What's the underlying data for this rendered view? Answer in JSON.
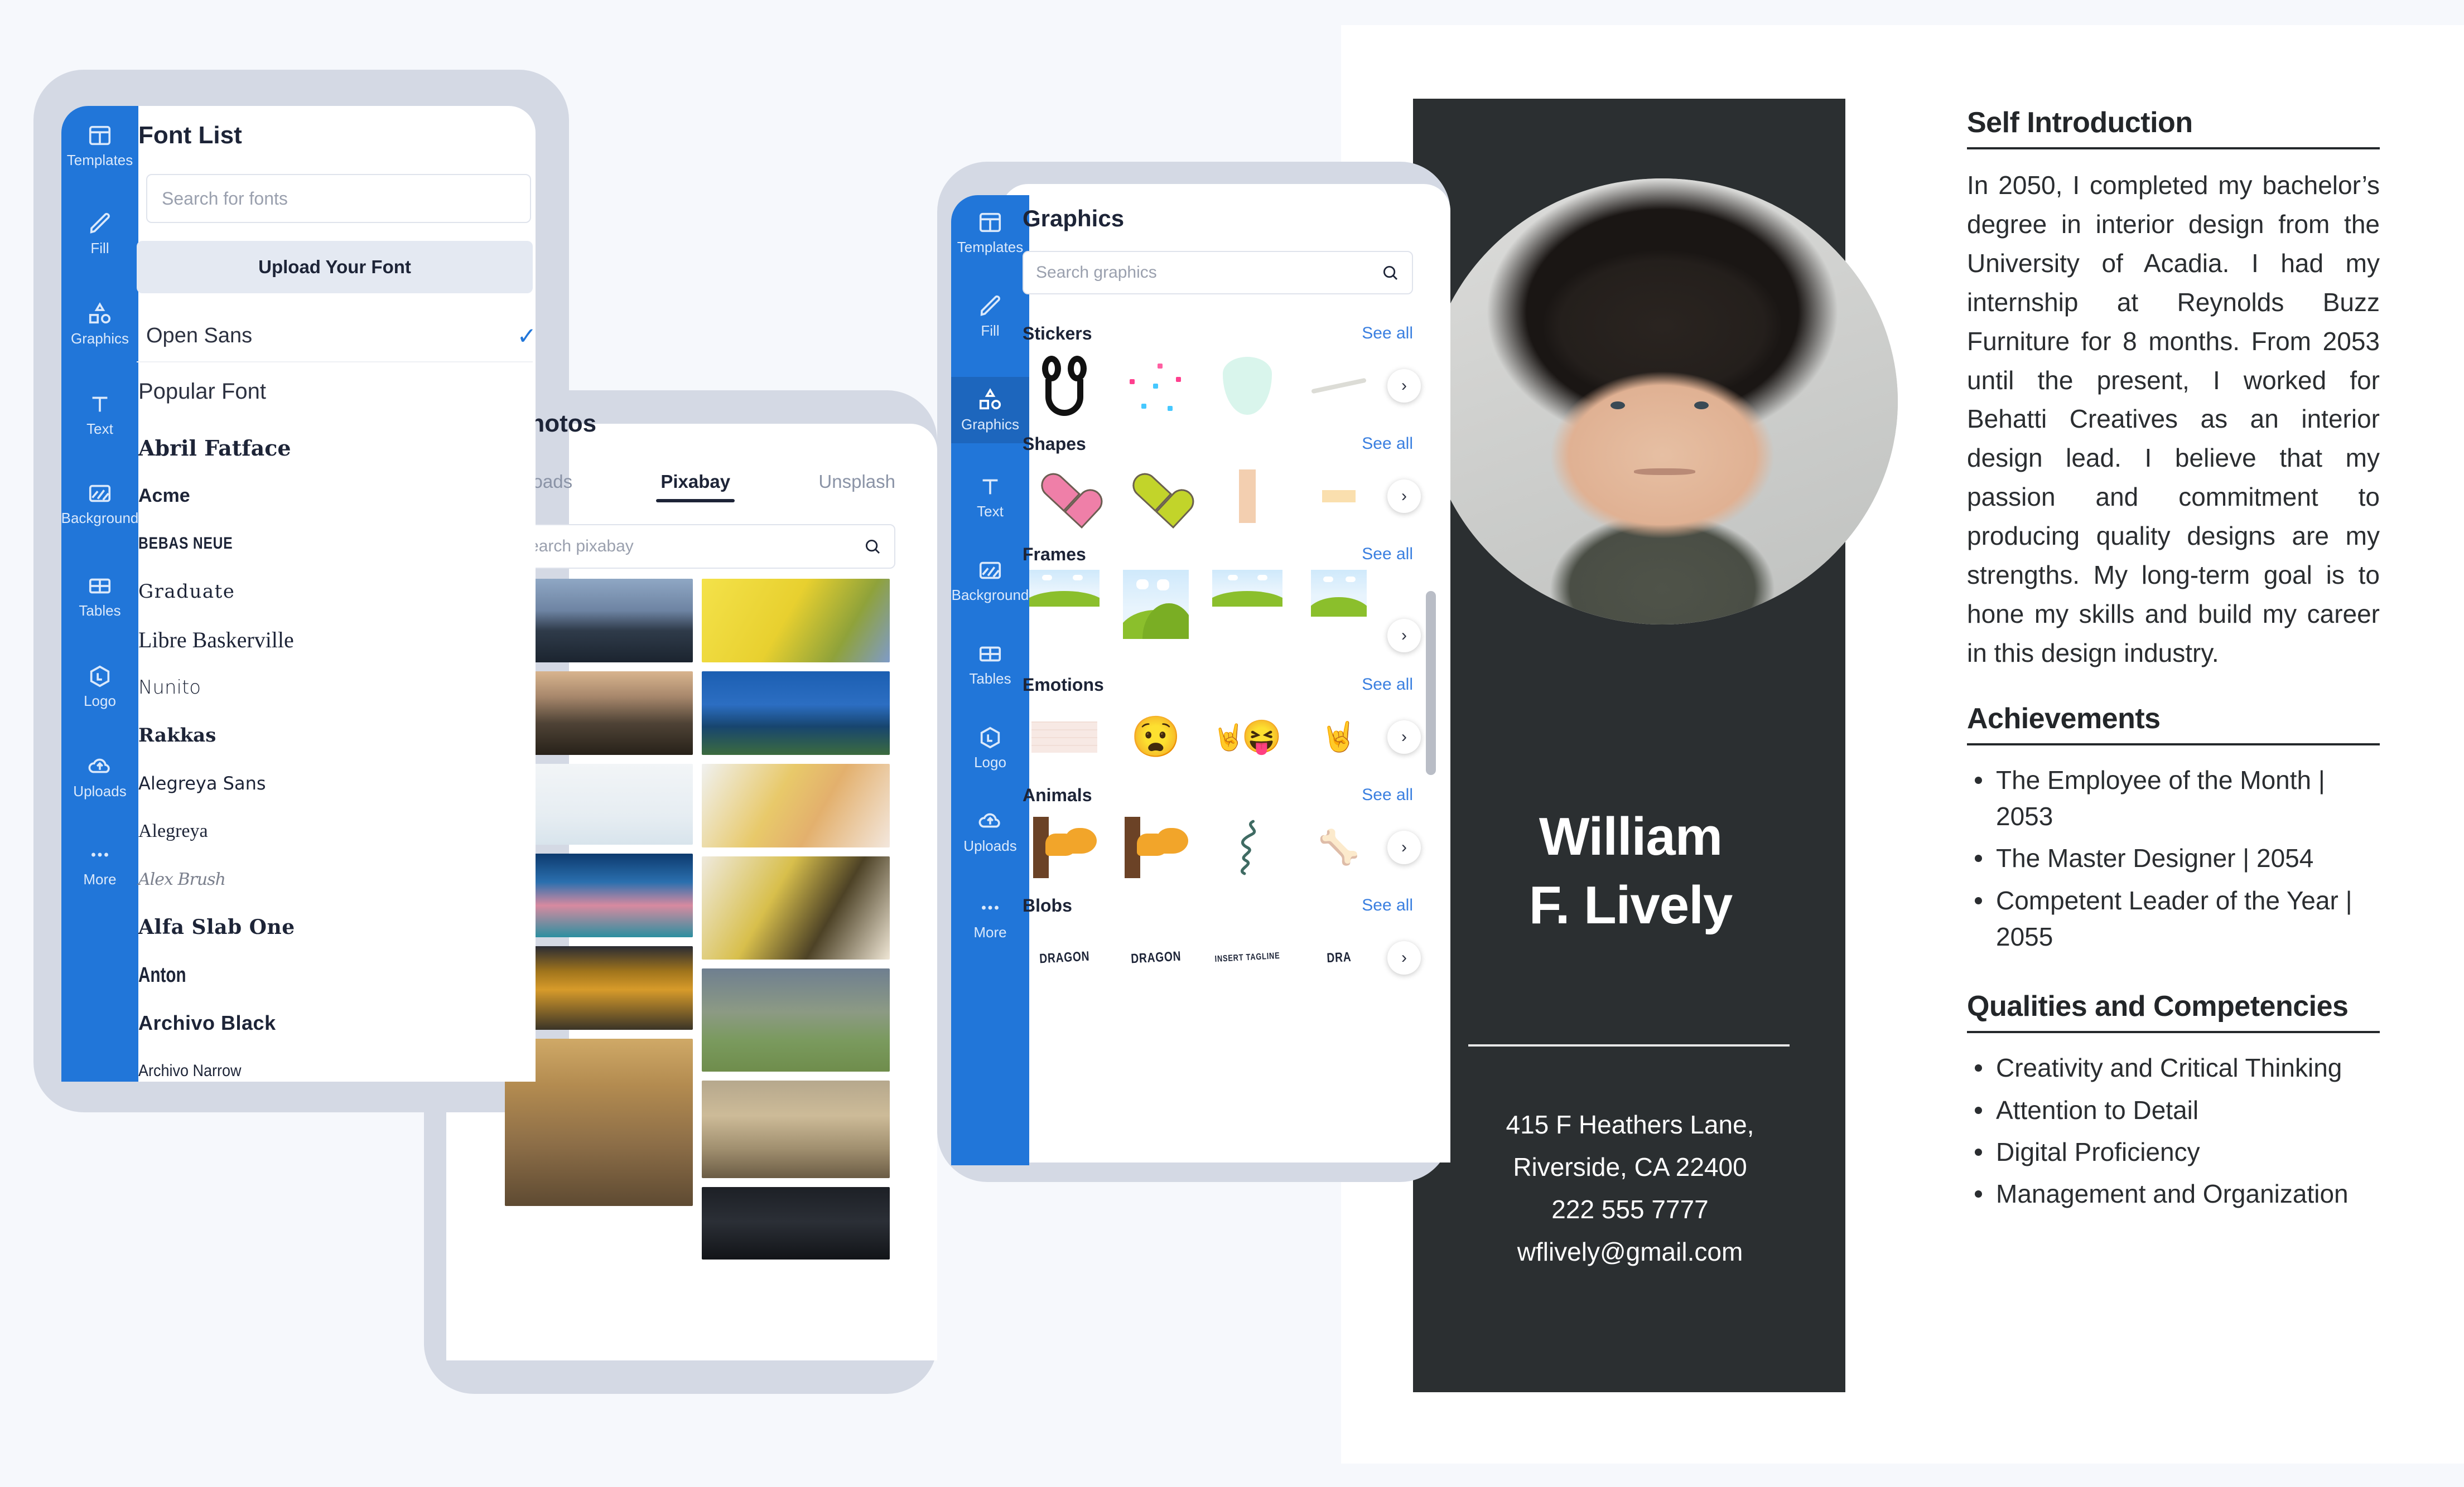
{
  "editor": {
    "rail_items": [
      {
        "label": "Templates",
        "icon": "templates-icon"
      },
      {
        "label": "Fill",
        "icon": "pencil-icon"
      },
      {
        "label": "Graphics",
        "icon": "shapes-icon"
      },
      {
        "label": "Text",
        "icon": "text-icon"
      },
      {
        "label": "Background",
        "icon": "background-icon"
      },
      {
        "label": "Tables",
        "icon": "tables-icon"
      },
      {
        "label": "Logo",
        "icon": "logo-icon"
      },
      {
        "label": "Uploads",
        "icon": "upload-cloud-icon"
      },
      {
        "label": "More",
        "icon": "more-dots-icon"
      }
    ]
  },
  "font_panel": {
    "title": "Font List",
    "search_placeholder": "Search for fonts",
    "upload_label": "Upload Your Font",
    "selected_font": "Open Sans",
    "selected_check": "✓",
    "group_label": "Popular Font",
    "fonts": [
      "Abril Fatface",
      "Acme",
      "BEBAS NEUE",
      "Graduate",
      "Libre Baskerville",
      "Nunito",
      "Rakkas",
      "Alegreya Sans",
      "Alegreya",
      "Alex Brush",
      "Alfa Slab One",
      "Anton",
      "Archivo Black",
      "Archivo Narrow"
    ]
  },
  "photos_panel": {
    "title": "Photos",
    "tabs": [
      {
        "label": "Uploads",
        "active": false
      },
      {
        "label": "Pixabay",
        "active": true
      },
      {
        "label": "Unsplash",
        "active": false
      }
    ],
    "search_placeholder": "Search pixabay",
    "search_icon": "search-icon"
  },
  "graphics_panel": {
    "title": "Graphics",
    "search_placeholder": "Search graphics",
    "search_icon": "search-icon",
    "see_all_label": "See all",
    "next_arrow": "›",
    "sections": [
      {
        "name": "Stickers"
      },
      {
        "name": "Shapes"
      },
      {
        "name": "Frames"
      },
      {
        "name": "Emotions"
      },
      {
        "name": "Animals"
      },
      {
        "name": "Blobs"
      }
    ],
    "blob_labels": [
      "DRAGON",
      "DRAGON",
      "INSERT TAGLINE",
      "DRA"
    ],
    "emotions": [
      "😧",
      "🤘",
      "😝",
      "🤘"
    ]
  },
  "resume": {
    "name_line1": "William",
    "name_line2": "F. Lively",
    "address_line1": "415 F Heathers Lane,",
    "address_line2": "Riverside, CA 22400",
    "phone": "222 555 7777",
    "email": "wflively@gmail.com",
    "sections": {
      "intro_title": "Self Introduction",
      "intro_body": "In 2050, I completed my bachelor’s degree in interior design from the University of Acadia. I had my internship at Reynolds Buzz Furniture for 8 months. From 2053 until the present, I worked for Behatti Creatives as an interior design lead. I believe that my passion and commitment to producing quality designs are my strengths. My long-term goal is to hone my skills and build my career in this design industry.",
      "achievements_title": "Achievements",
      "achievements": [
        "The Employee of the Month | 2053",
        "The Master Designer | 2054",
        "Competent Leader of the Year | 2055"
      ],
      "qualities_title": "Qualities and Competencies",
      "qualities": [
        "Creativity and Critical Thinking",
        "Attention to Detail",
        "Digital Proficiency",
        "Management and Organization"
      ]
    }
  },
  "colors": {
    "rail_blue": "#2176d9",
    "rail_blue_active": "#1d66bd",
    "panel_frame": "#d4d9e4",
    "page_bg": "#f6f8fc",
    "resume_dark": "#2b2f31",
    "link_blue": "#3a7fe0"
  }
}
